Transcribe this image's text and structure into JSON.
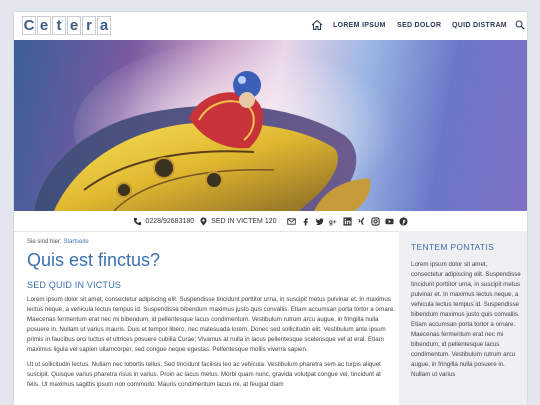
{
  "header": {
    "logo_letters": [
      "C",
      "e",
      "t",
      "e",
      "r",
      "a"
    ],
    "nav": [
      "LOREM IPSUM",
      "SED DOLOR",
      "QUID DISTRAM"
    ]
  },
  "contact": {
    "phone": "0228/92683180",
    "address": "SED IN VICTEM 120",
    "social_icons": [
      "mail-icon",
      "facebook-icon",
      "twitter-icon",
      "google-plus-icon",
      "linkedin-icon",
      "xing-icon",
      "instagram-icon",
      "youtube-icon",
      "pinterest-icon"
    ]
  },
  "breadcrumb": {
    "label": "Sie sind hier:",
    "link": "Startseite"
  },
  "main": {
    "title": "Quis est finctus?",
    "subtitle": "SED QUID IN VICTUS",
    "paragraph1": "Lorem ipsum dolor sit amet, consectetur adipiscing elit. Suspendisse tincidunt porttitor urna, in suscipit metus pulvinar et. In maximus lectus neque, a vehicula lectus tempus id. Suspendisse bibendum maximus justo quis convallis. Etiam accumsan porta tortor a ornare. Maecenas fermentum erat nec mi bibendum, id pellentesque lacus condimentum. Vestibulum rutrum arcu augue, in fringilla nulla posuere in. Nullam ut varius mauris. Duis et tempor libero, nec malesuada lorem. Donec sed sollicitudin elit. Vestibulum ante ipsum primis in faucibus orci luctus et ultrices posuere cubilia Curae; Vivamus at nulla in lacus pellentesque scelerisque vel at erat. Etiam maximus ligula vel sapien ullamcorper, sed congue neque egestas. Pellentesque mollis viverra sapien.",
    "paragraph2": "Ut ut sollicitudin lectus. Nullam nec lobortis tellus. Sed tincidunt facilisis leo ac vehicula. Vestibulum pharetra sem ac turpis aliquet suscipit. Quisque varius pharetra risus in varius. Proin ac lacus metus. Morbi quam nunc, gravida volutpat congue vel, tincidunt at felis. Ut maximus sagittis ipsum non commodo. Mauris condimentum lacus mi, at feugiat diam"
  },
  "sidebar": {
    "title": "TENTEM PONTATIS",
    "text": "Lorem ipsum dolor sit amet, consectetur adipiscing elit. Suspendisse tincidunt porttitor urna, in suscipit metus pulvinar et. In maximus lectus neque, a vehicula lectus tempus id. Suspendisse bibendum maximus justo quis convallis. Etiam accumsan porta tortor a ornare. Maecenas fermentum erat nec mi bibendum, id pellentesque lacus condimentum. Vestibulum rutrum arcu augue, in fringilla nulla posuere in. Nullam ut varius"
  },
  "colors": {
    "accent": "#3b6fb0",
    "nav_text": "#2b3b55",
    "sidebar_bg": "#f0f0f3"
  }
}
